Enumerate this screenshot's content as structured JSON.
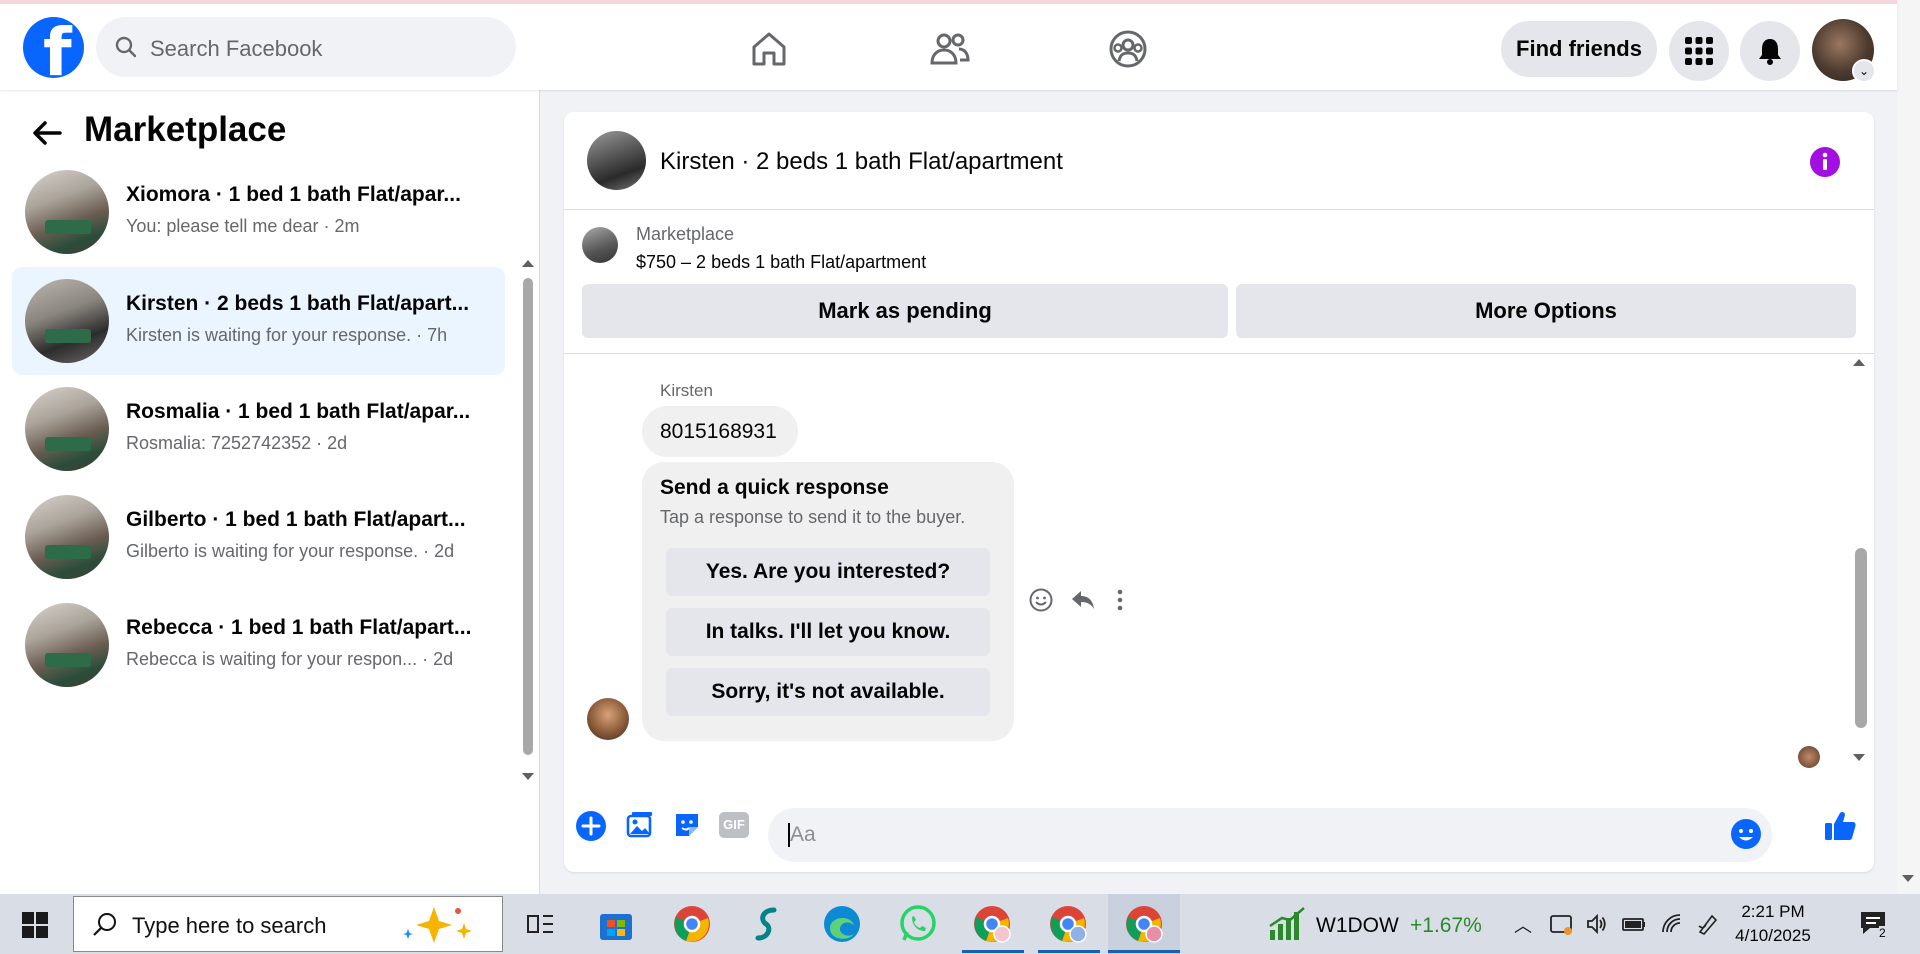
{
  "header": {
    "search_placeholder": "Search Facebook",
    "find_friends": "Find friends",
    "logo_letter": "f"
  },
  "sidebar": {
    "title": "Marketplace",
    "conversations": [
      {
        "name": "Xiomora · 1 bed 1 bath Flat/apar...",
        "preview": "You: please tell me dear · 2m",
        "active": false
      },
      {
        "name": "Kirsten · 2 beds 1 bath Flat/apart...",
        "preview": "Kirsten is waiting for your response. · 7h",
        "active": true
      },
      {
        "name": "Rosmalia · 1 bed 1 bath Flat/apar...",
        "preview": "Rosmalia: 7252742352 · 2d",
        "active": false
      },
      {
        "name": "Gilberto · 1 bed 1 bath Flat/apart...",
        "preview": "Gilberto is waiting for your response. · 2d",
        "active": false
      },
      {
        "name": "Rebecca · 1 bed 1 bath Flat/apart...",
        "preview": "Rebecca is waiting for your respon... · 2d",
        "active": false
      }
    ]
  },
  "chat": {
    "title": "Kirsten · 2 beds 1 bath Flat/apartment",
    "listing": {
      "source": "Marketplace",
      "price_line": "$750 – 2 beds 1 bath Flat/apartment",
      "mark_pending": "Mark as pending",
      "more_options": "More Options"
    },
    "sender_name": "Kirsten",
    "message": "8015168931",
    "quick_response": {
      "title": "Send a quick response",
      "subtitle": "Tap a response to send it to the buyer.",
      "options": [
        "Yes. Are you interested?",
        "In talks. I'll let you know.",
        "Sorry, it's not available."
      ]
    },
    "composer_placeholder": "Aa",
    "gif_label": "GIF"
  },
  "taskbar": {
    "search_placeholder": "Type here to search",
    "stock_name": "W1DOW",
    "stock_change": "+1.67%",
    "time": "2:21 PM",
    "date": "4/10/2025",
    "notification_count": "2"
  },
  "colors": {
    "brand": "#0866ff",
    "active_row": "#ebf5ff",
    "info_purple": "#a20fe0"
  }
}
